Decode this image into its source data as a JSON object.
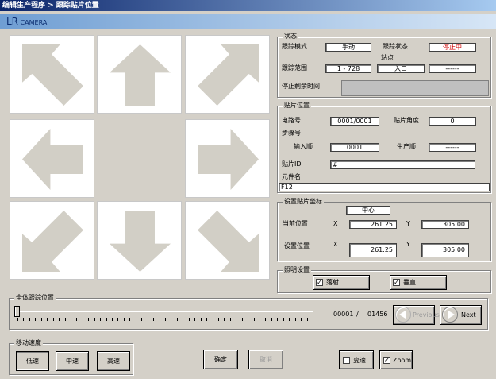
{
  "window": {
    "title": "编辑生产程序 > 跟踪贴片位置"
  },
  "camera": {
    "label": "LR",
    "sub": "CAMERA"
  },
  "status": {
    "group": "状态",
    "track_mode_label": "跟踪模式",
    "track_mode_value": "手动",
    "track_state_label": "跟踪状态",
    "track_state_value": "停止中",
    "station_label": "站点",
    "range_label": "跟踪范围",
    "range_value": "1 - 728",
    "station_value": "入口",
    "station_extra": "------",
    "remaining_label": "停止剩余时间"
  },
  "place": {
    "group": "贴片位置",
    "circuit_label": "电路号",
    "circuit_value": "0001/0001",
    "angle_label": "贴片角度",
    "angle_value": "0",
    "step_label": "步骤号",
    "input_label": "输入顺",
    "input_value": "0001",
    "prod_label": "生产顺",
    "prod_value": "------",
    "id_label": "贴片ID",
    "id_value": "#",
    "part_label": "元件名",
    "part_value": "F12"
  },
  "coords": {
    "group": "设置贴片坐标",
    "center": "中心",
    "current_label": "当前位置",
    "set_label": "设置位置",
    "x": "X",
    "y": "Y",
    "cur_x": "261.25",
    "cur_y": "305.00",
    "set_x": "261.25",
    "set_y": "305.00"
  },
  "light": {
    "group": "照明设置",
    "opt1": "落射",
    "opt2": "垂直",
    "opt1_checked": true,
    "opt2_checked": true
  },
  "track": {
    "group": "全体跟踪位置",
    "current": "00001",
    "sep": "/",
    "total": "01456",
    "prev": "Previous",
    "next": "Next",
    "position": 0.0
  },
  "speed": {
    "group": "移动速度",
    "slow": "低速",
    "mid": "中速",
    "fast": "高速"
  },
  "buttons": {
    "ok": "确定",
    "cancel": "取消",
    "skip": "变速",
    "skip_checked": false,
    "zoom": "Zoom",
    "zoom_checked": true
  }
}
